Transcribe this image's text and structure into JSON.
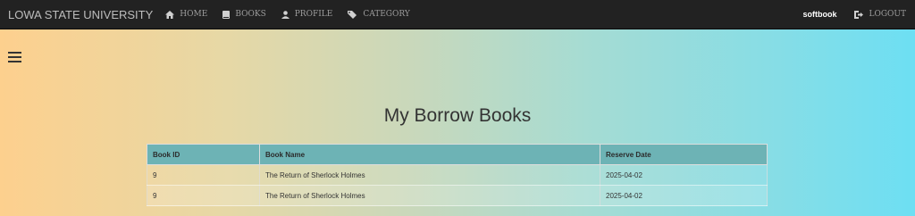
{
  "navbar": {
    "brand": "LOWA STATE UNIVERSITY",
    "items": [
      {
        "label": "HOME",
        "icon": "home-icon"
      },
      {
        "label": "BOOKS",
        "icon": "book-icon"
      },
      {
        "label": "PROFILE",
        "icon": "user-icon"
      },
      {
        "label": "CATEGORY",
        "icon": "tag-icon"
      }
    ],
    "username": "softbook",
    "logout_label": "LOGOUT",
    "logout_icon": "logout-icon"
  },
  "menu_toggle_icon": "hamburger-menu-icon",
  "main": {
    "title": "My Borrow Books",
    "table": {
      "headers": [
        "Book ID",
        "Book Name",
        "Reserve Date"
      ],
      "rows": [
        [
          "9",
          "The Return of Sherlock Holmes",
          "2025-04-02"
        ],
        [
          "9",
          "The Return of Sherlock Holmes",
          "2025-04-02"
        ]
      ]
    }
  },
  "colors": {
    "navbar_bg": "#222222",
    "header_row_bg": "#6db3b5",
    "gradient_left": "#fdd08e",
    "gradient_right": "#6ddff3"
  }
}
